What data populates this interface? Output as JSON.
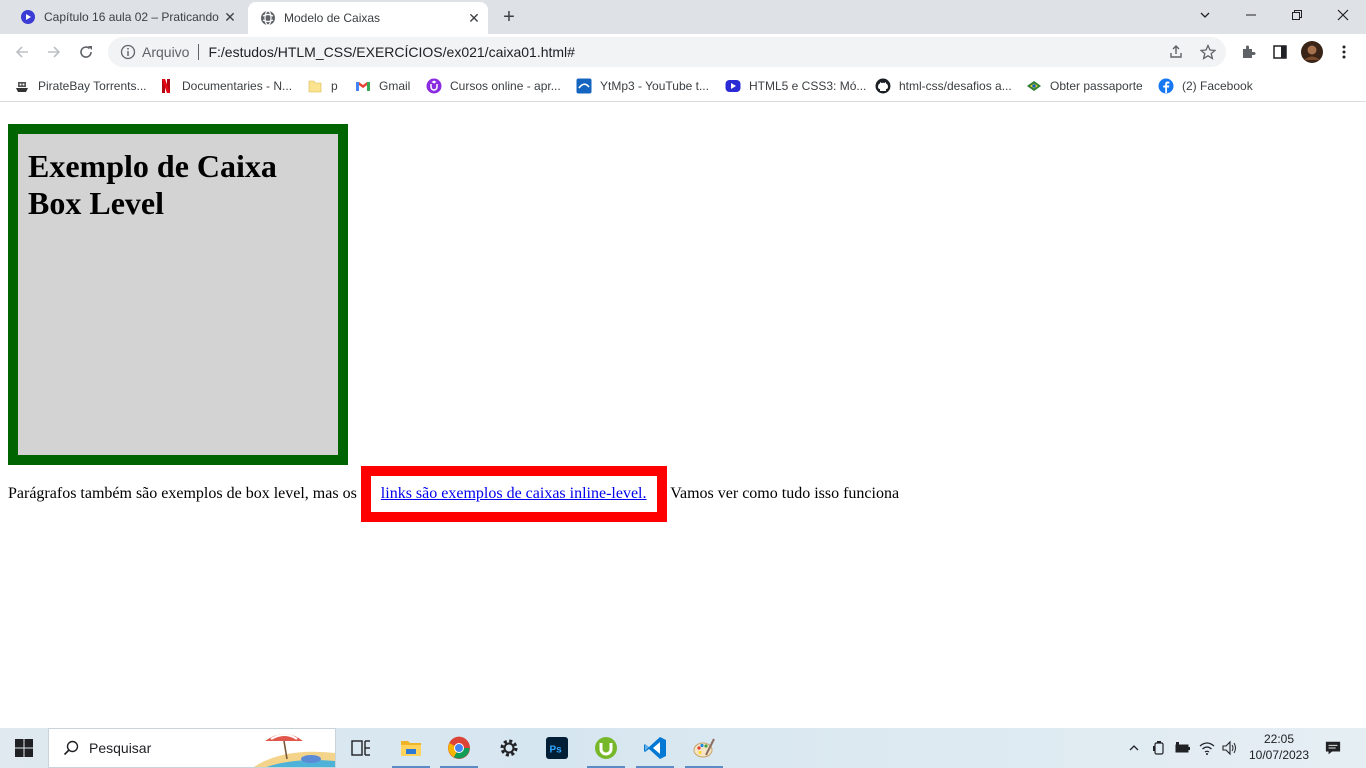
{
  "browser": {
    "tabs": [
      {
        "title": "Capítulo 16 aula 02 – Praticando",
        "active": false
      },
      {
        "title": "Modelo de Caixas",
        "active": true
      }
    ],
    "address": {
      "scheme": "Arquivo",
      "url": "F:/estudos/HTLM_CSS/EXERCÍCIOS/ex021/caixa01.html#"
    },
    "bookmarks": [
      {
        "label": "PirateBay Torrents...",
        "icon": "pirate-icon"
      },
      {
        "label": "Documentaries - N...",
        "icon": "netflix-icon"
      },
      {
        "label": "p",
        "icon": "folder-icon"
      },
      {
        "label": "Gmail",
        "icon": "gmail-icon"
      },
      {
        "label": "Cursos online - apr...",
        "icon": "udemy-icon"
      },
      {
        "label": "YtMp3 - YouTube t...",
        "icon": "ytmp3-icon"
      },
      {
        "label": "HTML5 e CSS3: Mó...",
        "icon": "curso-em-video-icon"
      },
      {
        "label": "html-css/desafios a...",
        "icon": "github-icon"
      },
      {
        "label": "Obter passaporte",
        "icon": "passport-icon"
      },
      {
        "label": "(2) Facebook",
        "icon": "facebook-icon"
      }
    ]
  },
  "page": {
    "heading": "Exemplo de Caixa Box Level",
    "paragraph_before": "Parágrafos também são exemplos de box level, mas os",
    "link": "links são exemplos de caixas inline-level.",
    "paragraph_after": "Vamos ver como tudo isso funciona",
    "colors": {
      "box_border": "#006400",
      "box_bg": "#d3d3d3",
      "link_border": "#ff0000",
      "link": "#0000ee"
    }
  },
  "taskbar": {
    "search_placeholder": "Pesquisar",
    "apps": [
      "task-view",
      "file-explorer",
      "chrome",
      "settings",
      "photoshop",
      "utorrent",
      "vscode",
      "paint"
    ],
    "time": "22:05",
    "date": "10/07/2023"
  }
}
